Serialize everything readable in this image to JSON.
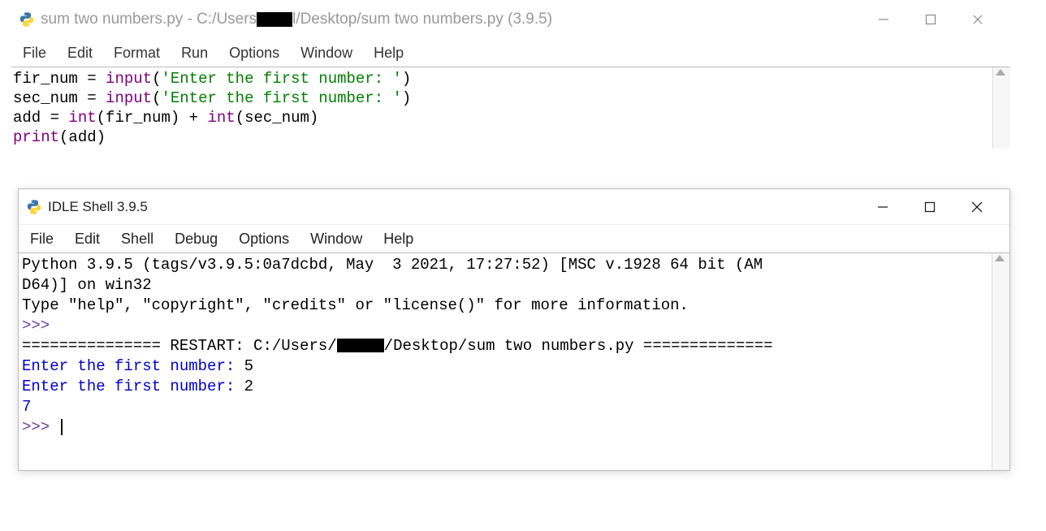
{
  "editor": {
    "title_prefix": "sum two numbers.py - C:/Users",
    "title_suffix": "l/Desktop/sum two numbers.py (3.9.5)",
    "menus": [
      "File",
      "Edit",
      "Format",
      "Run",
      "Options",
      "Window",
      "Help"
    ],
    "code": {
      "line1": {
        "var": "fir_num",
        "eq": " = ",
        "fn": "input",
        "paren_open": "(",
        "str": "'Enter the first number: '",
        "paren_close": ")"
      },
      "line2": {
        "var": "sec_num",
        "eq": " = ",
        "fn": "input",
        "paren_open": "(",
        "str": "'Enter the first number: '",
        "paren_close": ")"
      },
      "line3_a": "add = ",
      "line3_int1": "int",
      "line3_b": "(fir_num) + ",
      "line3_int2": "int",
      "line3_c": "(sec_num)",
      "line4_fn": "print",
      "line4_rest": "(add)"
    }
  },
  "shell": {
    "title": "IDLE Shell 3.9.5",
    "menus": [
      "File",
      "Edit",
      "Shell",
      "Debug",
      "Options",
      "Window",
      "Help"
    ],
    "banner1": "Python 3.9.5 (tags/v3.9.5:0a7dcbd, May  3 2021, 17:27:52) [MSC v.1928 64 bit (AM",
    "banner2": "D64)] on win32",
    "banner3": "Type \"help\", \"copyright\", \"credits\" or \"license()\" for more information.",
    "prompt": ">>>",
    "restart_pre": "=============== RESTART: C:/Users/",
    "restart_post": "/Desktop/sum two numbers.py ==============",
    "in1_label": "Enter the first number: ",
    "in1_val": "5",
    "in2_label": "Enter the first number: ",
    "in2_val": "2",
    "result": "7"
  }
}
